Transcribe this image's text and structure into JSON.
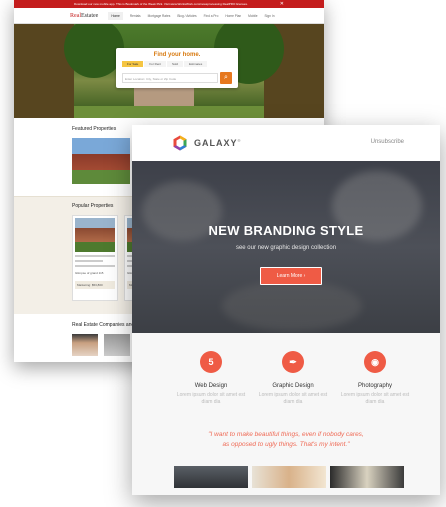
{
  "realestate": {
    "topbar_text": "Download our new mobile app. This is Bookmark of the Week Pick. Visit www.WorksWork.com/newsprocessing RealPRO licenses.",
    "topbar_close": "✕",
    "logo_part1": "Real",
    "logo_part2": "Estatee",
    "nav": [
      "Home",
      "Rentals",
      "Mortgage Rates",
      "Blog / Articles",
      "Find a Pro",
      "Home Plan",
      "Mobile",
      "Sign In"
    ],
    "search": {
      "title": "Find your home.",
      "tabs": [
        "For Sale",
        "For Rent",
        "Sold",
        "Estimates"
      ],
      "placeholder": "Enter Location: City, State or Zip Code",
      "go_icon": "search-icon"
    },
    "featured_title": "Featured Properties",
    "popular_title": "Popular Properties",
    "cards": [
      {
        "meta": "Glimpse of grand 115",
        "price": "Marketing: $53,800"
      },
      {
        "meta": "Glimpse of grand 115",
        "price": "Marketing: $53,800"
      }
    ],
    "companies_title": "Real Estate Companies and"
  },
  "galaxy": {
    "logo_name": "GALAXY",
    "logo_sup": "®",
    "unsubscribe": "Unsubscribe",
    "hero_title": "NEW BRANDING STYLE",
    "hero_sub": "see our new graphic design collection",
    "hero_button": "Learn More  ›",
    "features": [
      {
        "icon": "html5-icon",
        "glyph": "5",
        "title": "Web Design",
        "text": "Lorem ipsum dolor sit amet est diam dia"
      },
      {
        "icon": "pen-icon",
        "glyph": "✒",
        "title": "Graphic Design",
        "text": "Lorem ipsum dolor sit amet est diam dia"
      },
      {
        "icon": "camera-icon",
        "glyph": "◉",
        "title": "Photography",
        "text": "Lorem ipsum dolor sit amet est diam dia"
      }
    ],
    "quote_line1": "\"I want to make beautiful things, even if nobody cares,",
    "quote_line2": "as opposed to ugly things. That's my intent.\"",
    "colors": {
      "accent": "#ef5b45",
      "hero_bg": "#43464e"
    }
  }
}
